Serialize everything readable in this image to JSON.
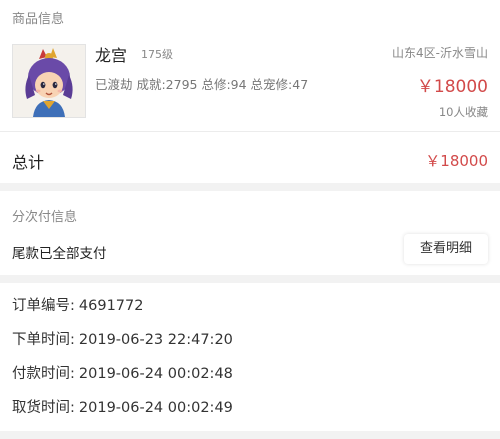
{
  "goods": {
    "section_title": "商品信息",
    "name": "龙宫",
    "level": "175级",
    "stats": "已渡劫 成就:2795 总修:94 总宠修:47",
    "server": "山东4区-沂水雪山",
    "price": "￥18000",
    "favorites": "10人收藏",
    "total_label": "总计",
    "total_value": "￥18000"
  },
  "payment": {
    "section_title": "分次付信息",
    "status": "尾款已全部支付",
    "detail_button": "查看明细"
  },
  "order": {
    "rows": [
      {
        "label": "订单编号:",
        "value": "4691772"
      },
      {
        "label": "下单时间:",
        "value": "2019-06-23 22:47:20"
      },
      {
        "label": "付款时间:",
        "value": "2019-06-24 00:02:48"
      },
      {
        "label": "取货时间:",
        "value": "2019-06-24 00:02:49"
      }
    ]
  },
  "colors": {
    "price": "#d24a4a",
    "page_bg": "#f2f2f2"
  }
}
